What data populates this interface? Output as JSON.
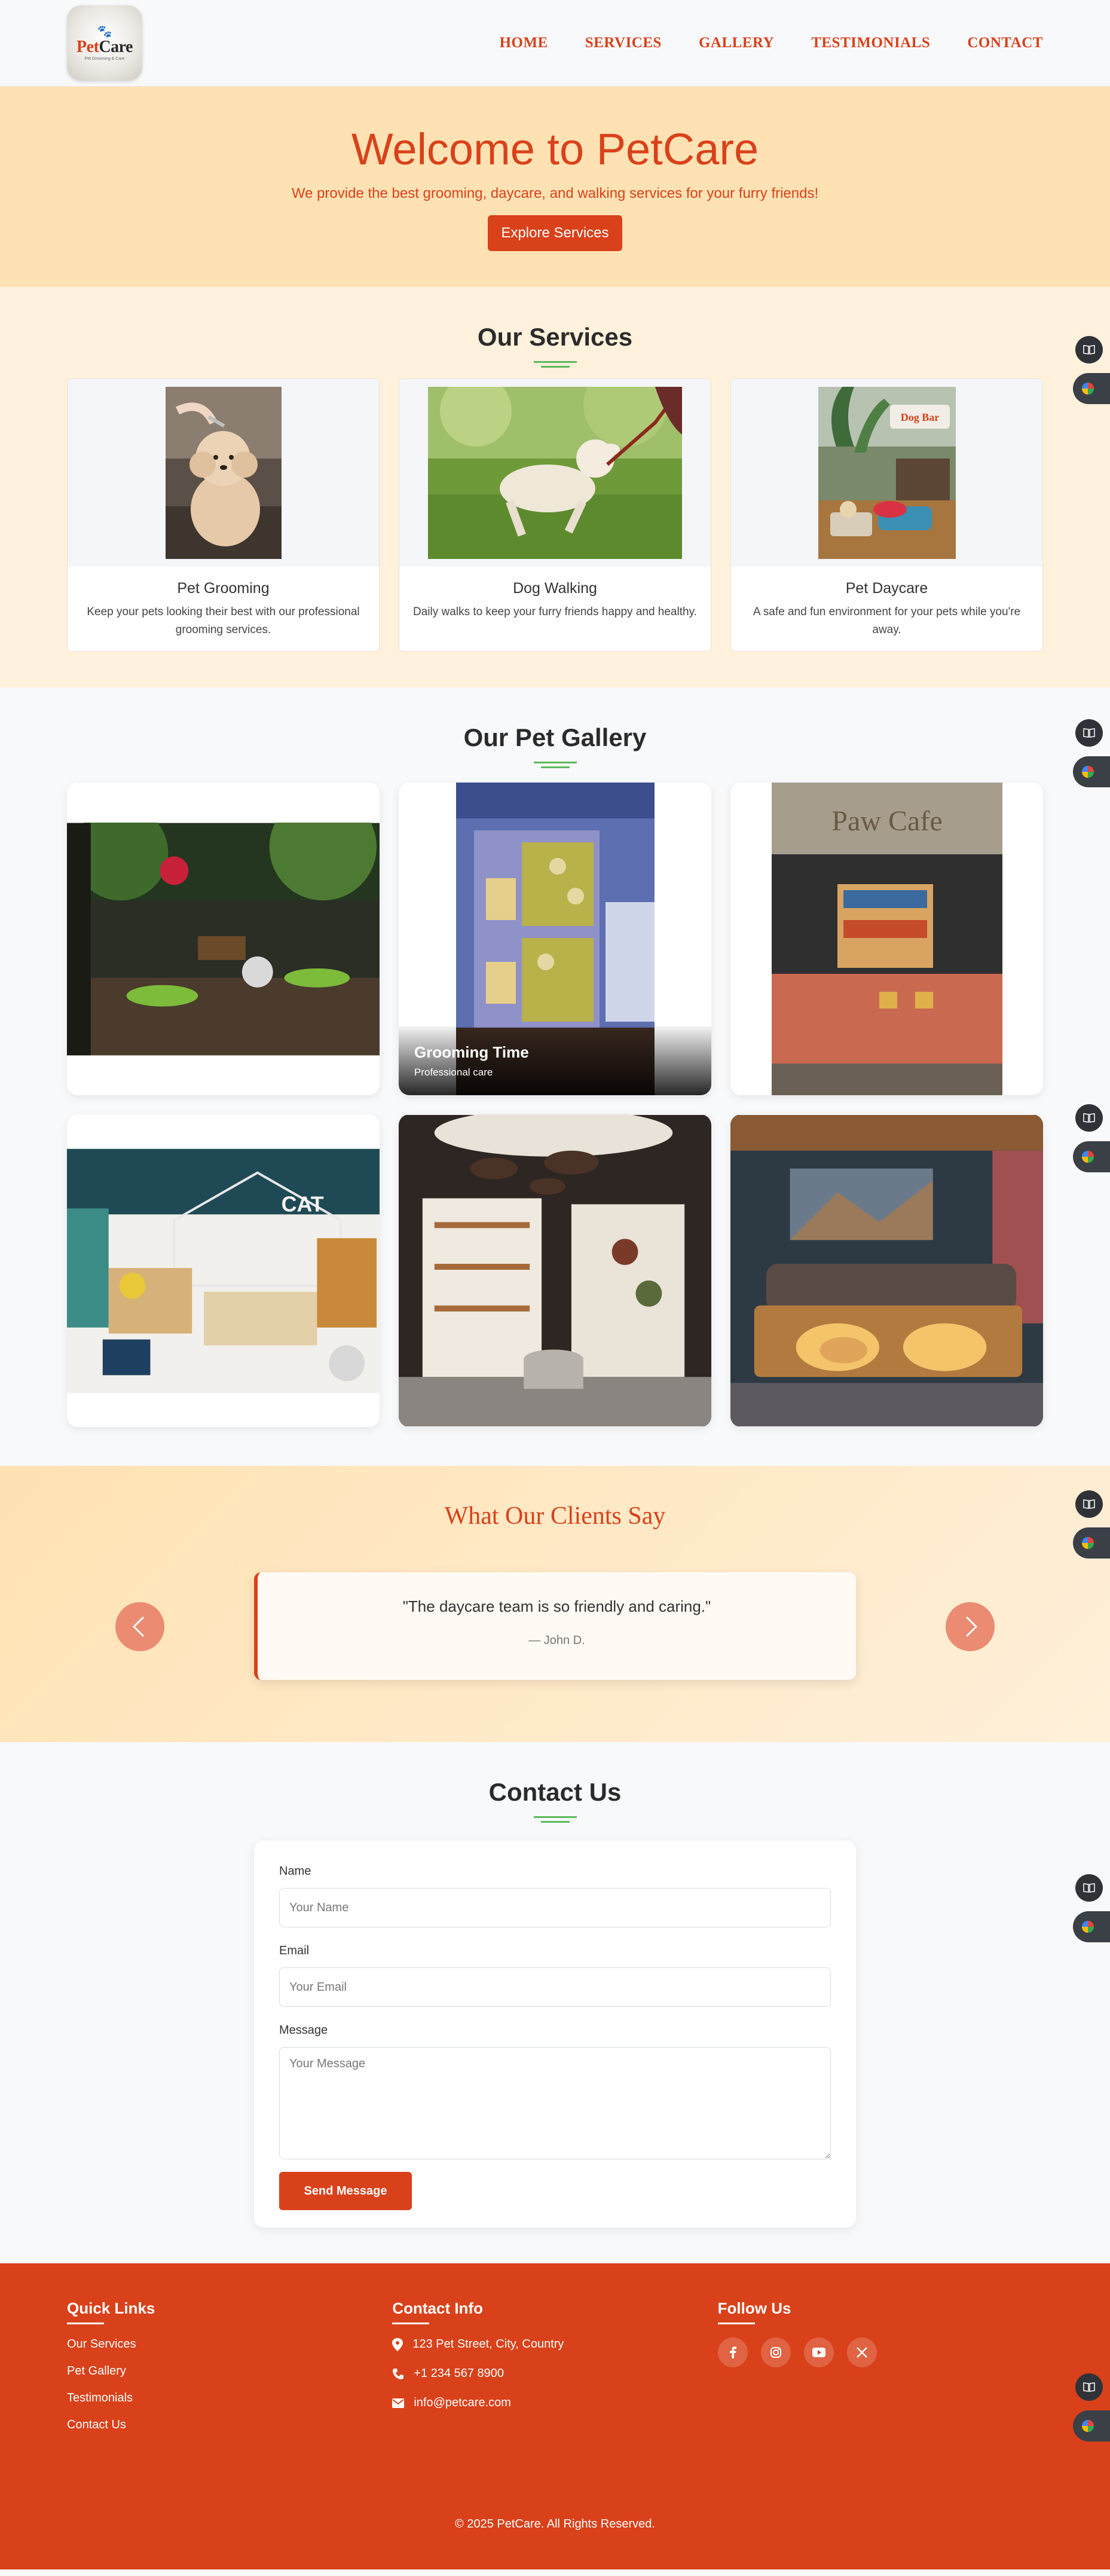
{
  "brand": {
    "name_part1": "Pet",
    "name_part2": "Care",
    "tagline": "Pet Grooming & Care"
  },
  "nav": {
    "links": [
      "HOME",
      "SERVICES",
      "GALLERY",
      "TESTIMONIALS",
      "CONTACT"
    ]
  },
  "hero": {
    "title": "Welcome to PetCare",
    "subtitle": "We provide the best grooming, daycare, and walking services for your furry friends!",
    "cta": "Explore Services"
  },
  "services": {
    "title": "Our Services",
    "items": [
      {
        "title": "Pet Grooming",
        "desc": "Keep your pets looking their best with our professional grooming services."
      },
      {
        "title": "Dog Walking",
        "desc": "Daily walks to keep your furry friends happy and healthy."
      },
      {
        "title": "Pet Daycare",
        "desc": "A safe and fun environment for your pets while you're away."
      }
    ]
  },
  "gallery": {
    "title": "Our Pet Gallery",
    "overlay": {
      "title": "Grooming Time",
      "subtitle": "Professional care"
    },
    "sign_dog_bar": "Dog Bar",
    "sign_paw_cafe": "Paw Cafe",
    "sign_store": "CAT"
  },
  "testimonials": {
    "title": "What Our Clients Say",
    "quote": "\"The daycare team is so friendly and caring.\"",
    "author": "— John D."
  },
  "contact": {
    "title": "Contact Us",
    "name_label": "Name",
    "name_placeholder": "Your Name",
    "email_label": "Email",
    "email_placeholder": "Your Email",
    "message_label": "Message",
    "message_placeholder": "Your Message",
    "submit": "Send Message"
  },
  "footer": {
    "quick_links_title": "Quick Links",
    "quick_links": [
      "Our Services",
      "Pet Gallery",
      "Testimonials",
      "Contact Us"
    ],
    "contact_title": "Contact Info",
    "address": "123 Pet Street, City, Country",
    "phone": "+1 234 567 8900",
    "email": "info@petcare.com",
    "follow_title": "Follow Us",
    "copyright": "© 2025 PetCare. All Rights Reserved."
  },
  "colors": {
    "accent": "#d9411a",
    "hero_bg": "#ffe2b3",
    "services_bg": "#fff1dc",
    "underline": "#5cb85c"
  },
  "icons": [
    "paw-icon",
    "map-marker-icon",
    "phone-icon",
    "envelope-icon",
    "facebook-icon",
    "instagram-icon",
    "youtube-icon",
    "x-icon",
    "chevron-left-icon",
    "chevron-right-icon",
    "book-icon",
    "google-icon"
  ]
}
